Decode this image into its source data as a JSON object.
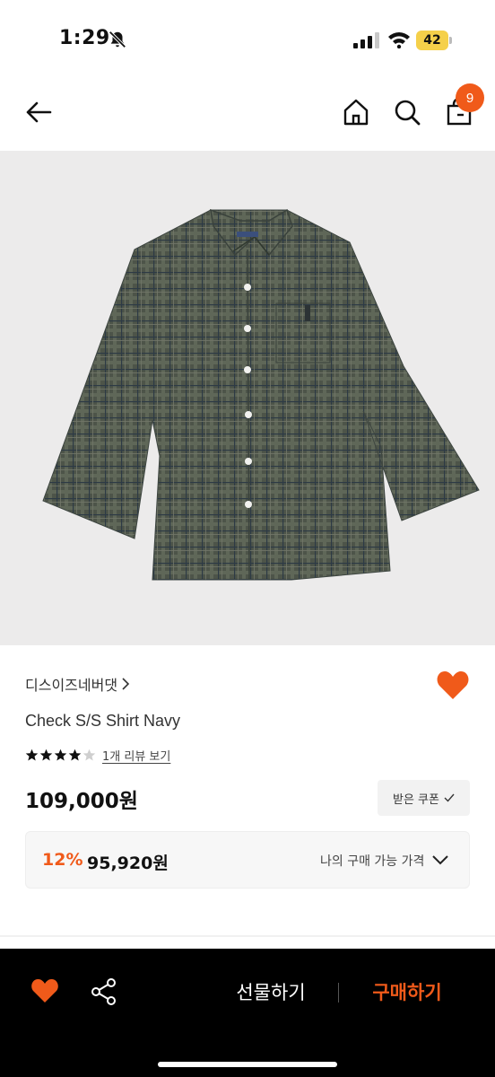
{
  "status_bar": {
    "time": "1:29",
    "battery": "42"
  },
  "header": {
    "cart_count": "9",
    "icons": [
      "back-arrow-icon",
      "home-icon",
      "search-icon",
      "shopping-bag-icon"
    ]
  },
  "product": {
    "brand": "디스이즈네버댓",
    "name": "Check S/S Shirt Navy",
    "rating": 4,
    "rating_max": 5,
    "review_link": "1개 리뷰 보기",
    "price": "109,000원",
    "coupon_label": "받은 쿠폰",
    "discount_percent": "12%",
    "discount_price": "95,920원",
    "my_price_label": "나의 구매 가능 가격",
    "favorited": true
  },
  "bottom_bar": {
    "gift_label": "선물하기",
    "buy_label": "구매하기"
  },
  "colors": {
    "accent": "#f05a1a",
    "bottom_bar_bg": "#000000",
    "image_bg": "#ecebeb",
    "battery": "#f5d04a"
  }
}
